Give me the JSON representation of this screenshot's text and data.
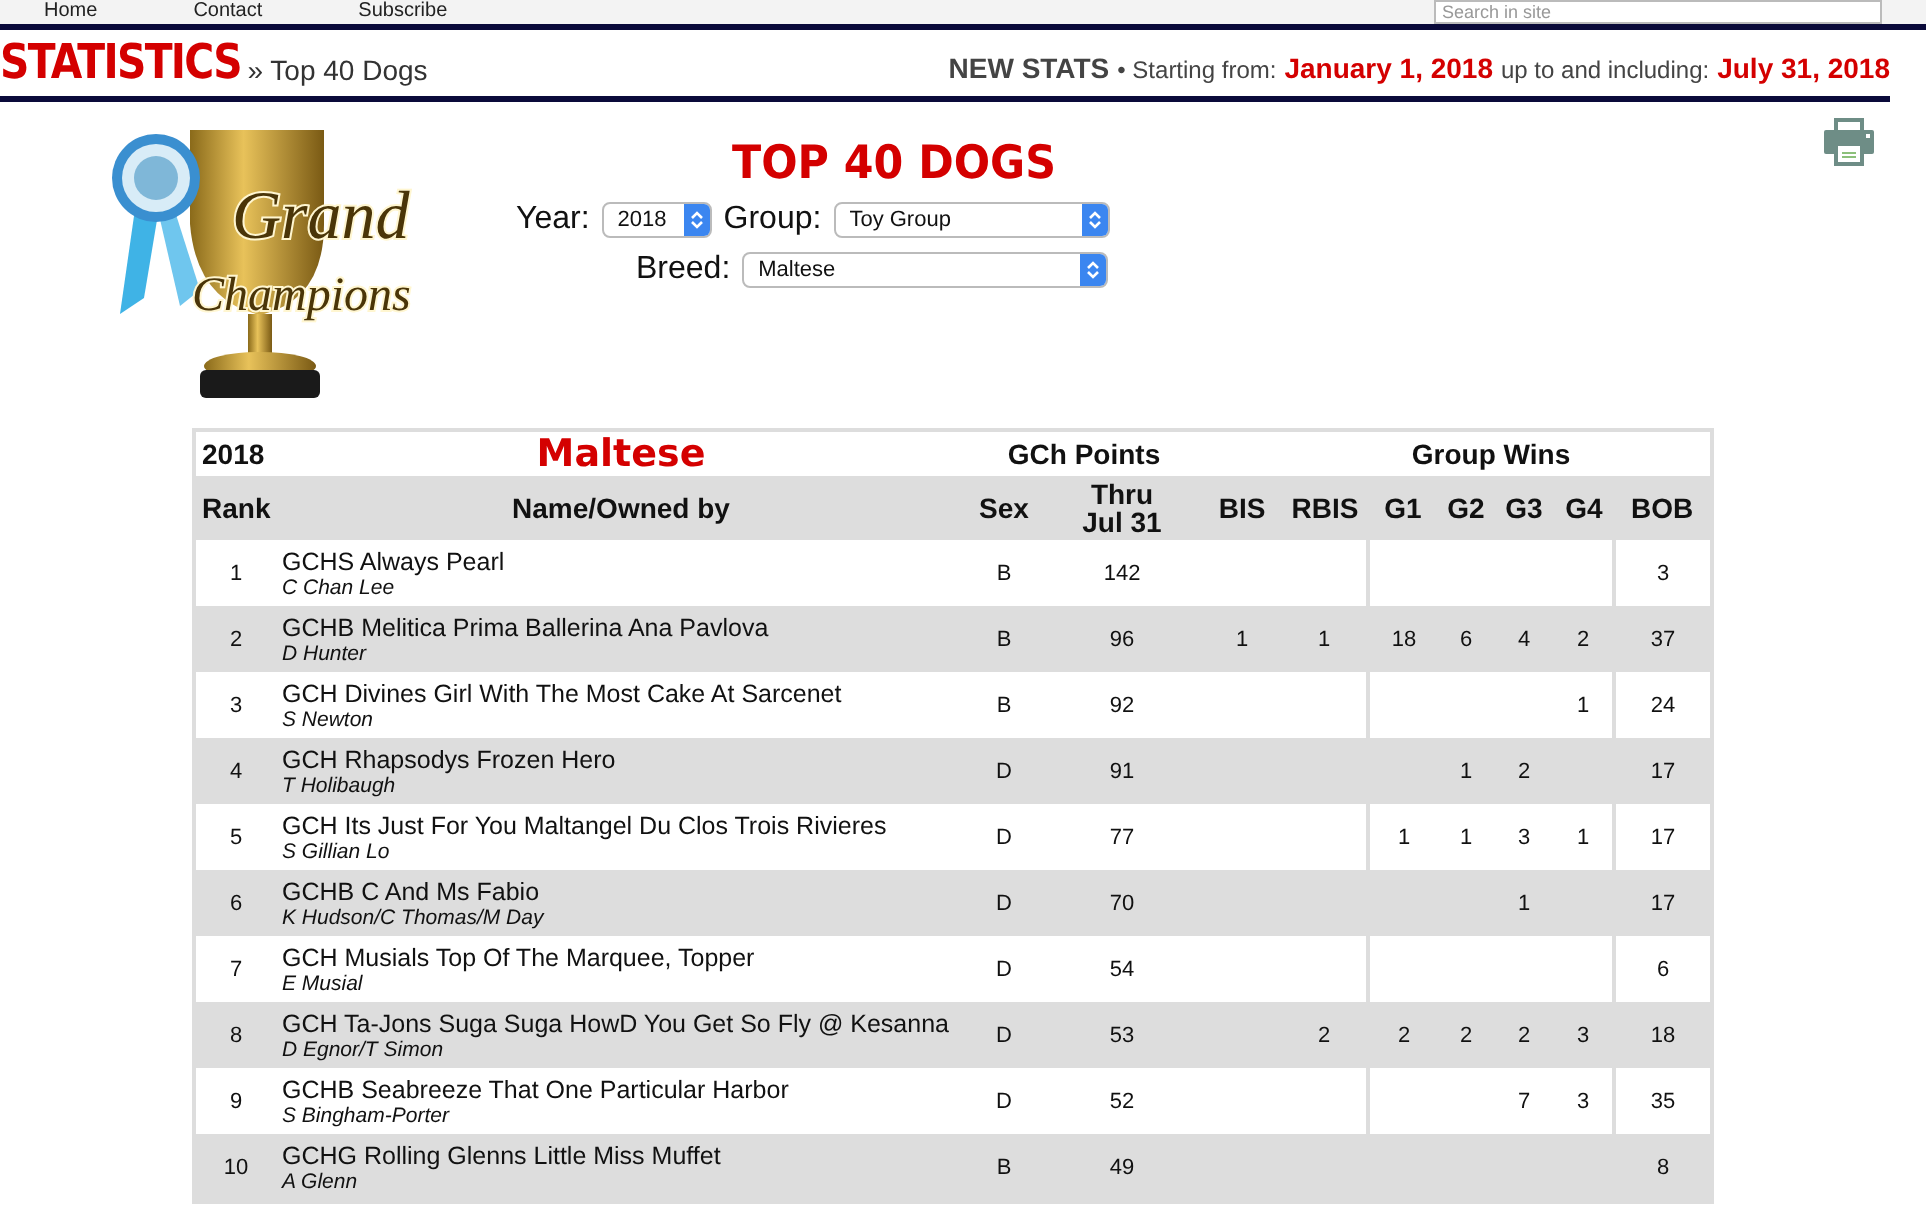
{
  "nav": {
    "items": [
      {
        "label": "Home"
      },
      {
        "label": "Contact"
      },
      {
        "label": "Subscribe"
      }
    ],
    "search": {
      "placeholder": "Search in site"
    }
  },
  "header": {
    "title": "STATISTICS",
    "breadcrumb": "» Top 40 Dogs",
    "new_stats": "NEW STATS",
    "starting_label": "• Starting from:",
    "start_date": "January 1, 2018",
    "through_label": "up to and including:",
    "end_date": "July 31, 2018"
  },
  "logo": {
    "line_1": "Grand",
    "line_2": "Champions"
  },
  "filters": {
    "title": "TOP 40 DOGS",
    "year_label": "Year:",
    "year": "2018",
    "group_label": "Group:",
    "group": "Toy Group",
    "breed_label": "Breed:",
    "breed": "Maltese"
  },
  "table": {
    "year": "2018",
    "breed": "Maltese",
    "points_group": "GCh Points",
    "wins_group": "Group Wins",
    "columns": [
      "Rank",
      "Name/Owned by",
      "Sex",
      "Thru Jul 31",
      "BIS",
      "RBIS",
      "G1",
      "G2",
      "G3",
      "G4",
      "BOB"
    ],
    "rows": [
      {
        "rank": "1",
        "name": "GCHS Always Pearl",
        "owner": "C Chan Lee",
        "sex": "B",
        "points": "142",
        "bob": "3"
      },
      {
        "rank": "2",
        "name": "GCHB Melitica Prima Ballerina Ana Pavlova",
        "owner": "D Hunter",
        "sex": "B",
        "points": "96",
        "bis": "1",
        "rbis": "1",
        "g1": "18",
        "g2": "6",
        "g3": "4",
        "g4": "2",
        "bob": "37"
      },
      {
        "rank": "3",
        "name": "GCH Divines Girl With The Most Cake At Sarcenet",
        "owner": "S Newton",
        "sex": "B",
        "points": "92",
        "g4": "1",
        "bob": "24"
      },
      {
        "rank": "4",
        "name": "GCH Rhapsodys Frozen Hero",
        "owner": "T Holibaugh",
        "sex": "D",
        "points": "91",
        "g2": "1",
        "g3": "2",
        "bob": "17"
      },
      {
        "rank": "5",
        "name": "GCH Its Just For You Maltangel Du Clos Trois Rivieres",
        "owner": "S Gillian Lo",
        "sex": "D",
        "points": "77",
        "g1": "1",
        "g2": "1",
        "g3": "3",
        "g4": "1",
        "bob": "17"
      },
      {
        "rank": "6",
        "name": "GCHB C And Ms Fabio",
        "owner": "K Hudson/C Thomas/M Day",
        "sex": "D",
        "points": "70",
        "g3": "1",
        "bob": "17"
      },
      {
        "rank": "7",
        "name": "GCH Musials Top Of The Marquee, Topper",
        "owner": "E Musial",
        "sex": "D",
        "points": "54",
        "bob": "6"
      },
      {
        "rank": "8",
        "name": "GCH Ta-Jons Suga Suga HowD You Get So Fly @ Kesanna",
        "owner": "D Egnor/T Simon",
        "sex": "D",
        "points": "53",
        "rbis": "2",
        "g1": "2",
        "g2": "2",
        "g3": "2",
        "g4": "3",
        "bob": "18"
      },
      {
        "rank": "9",
        "name": "GCHB Seabreeze That One Particular Harbor",
        "owner": "S Bingham-Porter",
        "sex": "D",
        "points": "52",
        "g3": "7",
        "g4": "3",
        "bob": "35"
      },
      {
        "rank": "10",
        "name": "GCHG Rolling Glenns Little Miss Muffet",
        "owner": "A Glenn",
        "sex": "B",
        "points": "49",
        "bob": "8"
      }
    ]
  }
}
